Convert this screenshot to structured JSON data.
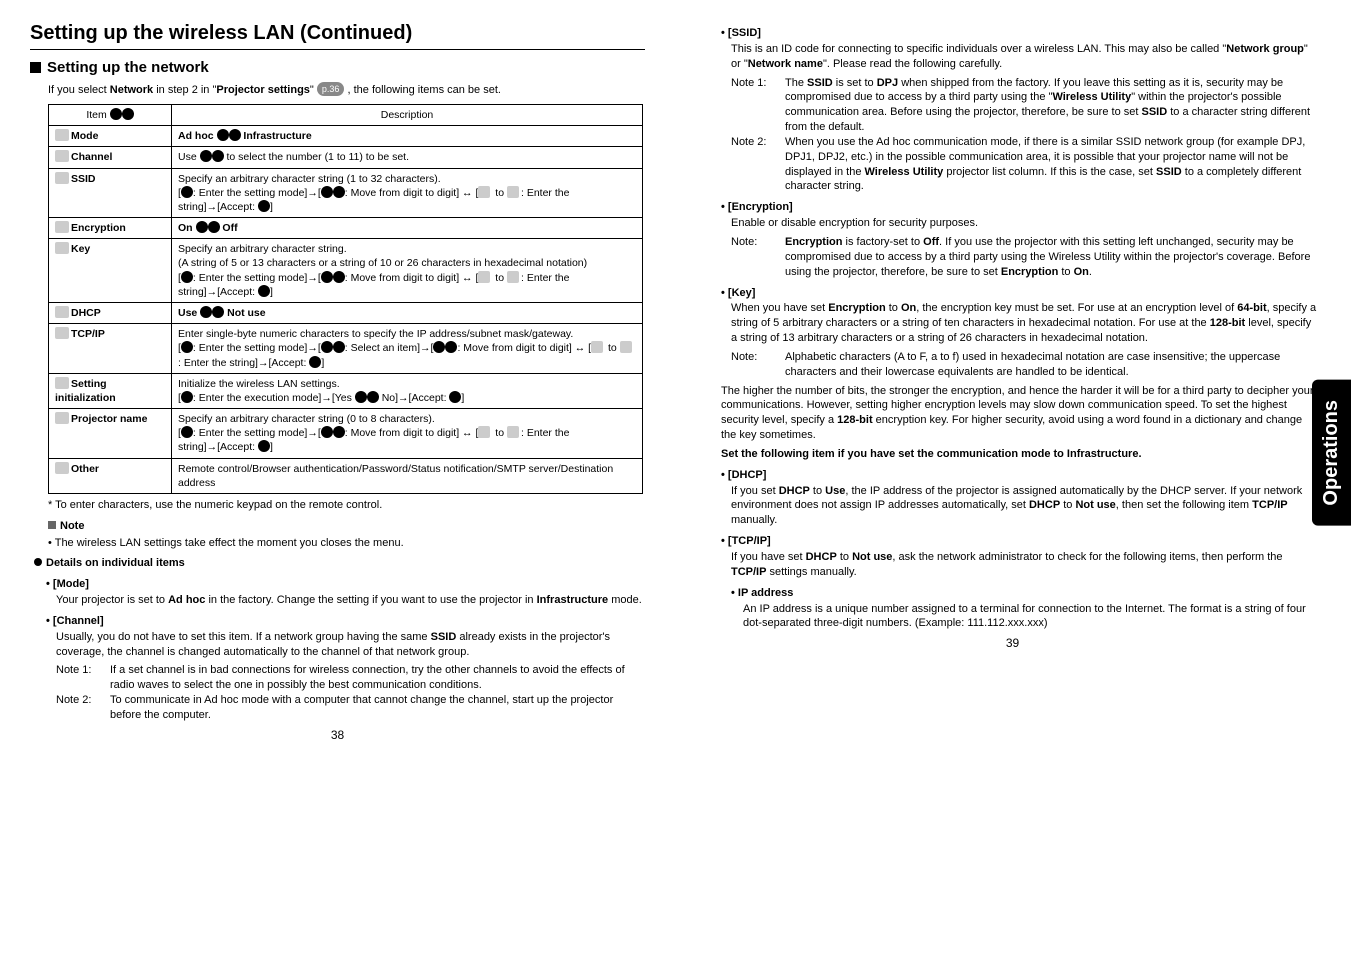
{
  "main_title": "Setting up the wireless LAN (Continued)",
  "sub_heading": "Setting up the network",
  "intro_prefix": "If you select ",
  "intro_network": "Network",
  "intro_mid": " in step 2 in \"",
  "intro_ps": "Projector settings",
  "intro_quote_close": "\" ",
  "intro_badge": "p.36",
  "intro_suffix": " , the following items can be set.",
  "table_header_item": "Item",
  "table_header_desc": "Description",
  "rows": {
    "mode": {
      "item": "Mode",
      "desc_pre": "Ad hoc ",
      "desc_post": " Infrastructure"
    },
    "channel": {
      "item": "Channel",
      "desc": "Use  to select the number (1 to 11) to be set."
    },
    "ssid": {
      "item": "SSID",
      "desc": "Specify an arbitrary character string (1 to 32 characters).\n[ : Enter the setting mode]→[  : Move from digit to digit] ↔ [  to  : Enter the string]→[Accept:  ]"
    },
    "encryption": {
      "item": "Encryption",
      "desc_pre": "On ",
      "desc_post": " Off"
    },
    "key": {
      "item": "Key",
      "desc": "Specify an arbitrary character string.\n(A string of 5 or 13 characters or a string of 10 or 26 characters in hexadecimal notation)\n[ : Enter the setting mode]→[  : Move from digit to digit] ↔ [  to  : Enter the string]→[Accept:  ]"
    },
    "dhcp": {
      "item": "DHCP",
      "desc_pre": "Use ",
      "desc_post": " Not use"
    },
    "tcpip": {
      "item": "TCP/IP",
      "desc": "Enter single-byte numeric characters to specify the IP address/subnet mask/gateway.\n[ : Enter the setting mode]→[  : Select an item]→[  : Move from digit to digit] ↔ [  to  : Enter the string]→[Accept:  ]"
    },
    "settinginit": {
      "item": "Setting initialization",
      "desc": "Initialize the wireless LAN settings.\n[ : Enter the execution mode]→[Yes   No]→[Accept:  ]"
    },
    "projname": {
      "item": "Projector name",
      "desc": "Specify an arbitrary character string (0 to 8 characters).\n[ : Enter the setting mode]→[  : Move from digit to digit] ↔ [  to  : Enter the string]→[Accept:  ]"
    },
    "other": {
      "item": "Other",
      "desc": "Remote control/Browser authentication/Password/Status notification/SMTP server/Destination address"
    }
  },
  "footnote": "* To enter characters, use the numeric keypad on the remote control.",
  "note_title": "Note",
  "note_line": "The wireless LAN settings take effect the moment you closes the menu.",
  "details_heading": "Details on individual items",
  "mode_label": "[Mode]",
  "mode_body_1": "Your projector is set to ",
  "mode_body_adhoc": "Ad hoc",
  "mode_body_2": " in the factory. Change the setting if you want to use the projector in ",
  "mode_body_infra": "Infrastructure",
  "mode_body_3": " mode.",
  "channel_label": "[Channel]",
  "channel_body_1": "Usually, you do not have to set this item. If a network group having the same ",
  "channel_body_ssid": "SSID",
  "channel_body_2": " already exists in the projector's coverage, the channel is changed automatically to the channel of that network group.",
  "channel_note1_tag": "Note 1:",
  "channel_note1": "If a set channel is in bad connections for wireless connection, try the other channels to avoid the effects of radio waves to select the one in possibly the best communication conditions.",
  "channel_note2_tag": "Note 2:",
  "channel_note2": "To communicate in Ad hoc mode with a computer that cannot change the channel, start up the projector before the computer.",
  "ssid_label": "[SSID]",
  "ssid_body_1": "This is an ID code for connecting to specific individuals over a wireless LAN.  This may also be called \"",
  "ssid_body_ng": "Network group",
  "ssid_body_2": "\" or \"",
  "ssid_body_nn": "Network name",
  "ssid_body_3": "\".  Please read the following carefully.",
  "ssid_note1_tag": "Note 1:",
  "ssid_note1_a": "The ",
  "ssid_note1_ssid": "SSID",
  "ssid_note1_b": " is set to ",
  "ssid_note1_dpj": "DPJ",
  "ssid_note1_c": " when shipped from the factory. If you leave this setting as it is, security may be compromised due to access by a third party using the \"",
  "ssid_note1_wu": "Wireless Utility",
  "ssid_note1_d": "\" within the projector's possible communication area. Before using the projector, therefore, be sure to set ",
  "ssid_note1_ssid2": "SSID",
  "ssid_note1_e": " to a character string different from the default.",
  "ssid_note2_tag": "Note 2:",
  "ssid_note2_a": "When you use the Ad hoc communication mode, if there is a similar SSID network group (for example DPJ, DPJ1, DPJ2, etc.) in the possible communication area, it is possible that your projector name will not be displayed in the ",
  "ssid_note2_wu": "Wireless Utility",
  "ssid_note2_b": " projector list column. If this is the case, set ",
  "ssid_note2_ssid": "SSID",
  "ssid_note2_c": " to a completely different character string.",
  "enc_label": "[Encryption]",
  "enc_body": "Enable or disable encryption for security purposes.",
  "enc_note_tag": "Note:",
  "enc_note_a": "Encryption",
  "enc_note_b": " is factory-set to ",
  "enc_note_off": "Off",
  "enc_note_c": ". If you use the projector with this setting left unchanged, security may be compromised due to access by a third party using the Wireless Utility within the projector's coverage. Before using the projector, therefore, be sure to set ",
  "enc_note_enc2": "Encryption",
  "enc_note_d": " to ",
  "enc_note_on": "On",
  "enc_note_e": ".",
  "key_label": "[Key]",
  "key_body_a": "When you have set ",
  "key_body_enc": "Encryption",
  "key_body_b": " to ",
  "key_body_on": "On",
  "key_body_c": ", the encryption key must be set. For use at an encryption level of ",
  "key_body_64": "64-bit",
  "key_body_d": ", specify a string of 5 arbitrary characters or a string of ten characters in hexadecimal notation. For use at the ",
  "key_body_128": "128-bit",
  "key_body_e": " level, specify a string of 13 arbitrary characters or a string of 26 characters in hexadecimal notation.",
  "key_note_tag": "Note:",
  "key_note": "Alphabetic characters (A to F, a to f) used in hexadecimal notation are case insensitive; the uppercase characters and their lowercase equivalents are handled to be identical.",
  "key_para2_a": "The higher the number of bits, the stronger the encryption, and hence the harder it will be for a third party to decipher your communications. However, setting higher encryption levels may slow down communication speed. To set the highest security level, specify a ",
  "key_para2_128": "128-bit",
  "key_para2_b": " encryption key. For higher security, avoid using a word found in a dictionary and change the key sometimes.",
  "infra_line": "Set the following item if you have set the communication mode to Infrastructure.",
  "dhcp_label": "[DHCP]",
  "dhcp_body_a": "If you set ",
  "dhcp_body_dhcp": "DHCP",
  "dhcp_body_b": " to ",
  "dhcp_body_use": "Use",
  "dhcp_body_c": ", the IP address of the projector is assigned automatically by the DHCP server. If your network environment does not assign IP addresses automatically, set ",
  "dhcp_body_dhcp2": "DHCP",
  "dhcp_body_d": " to ",
  "dhcp_body_notuse": "Not use",
  "dhcp_body_e": ", then set the following item ",
  "dhcp_body_tcpip": "TCP/IP",
  "dhcp_body_f": " manually.",
  "tcpip_label": "[TCP/IP]",
  "tcpip_body_a": "If you have set ",
  "tcpip_body_dhcp": "DHCP",
  "tcpip_body_b": " to ",
  "tcpip_body_notuse": "Not use",
  "tcpip_body_c": ", ask the network administrator to check for the following items, then perform the ",
  "tcpip_body_tcpip": "TCP/IP",
  "tcpip_body_d": " settings manually.",
  "ip_label": "IP address",
  "ip_body": "An IP address is a unique number assigned to a terminal for connection to the Internet. The format is a string of four dot-separated three-digit numbers. (Example: 111.112.xxx.xxx)",
  "page_left": "38",
  "page_right": "39",
  "sidetab": "Operations"
}
